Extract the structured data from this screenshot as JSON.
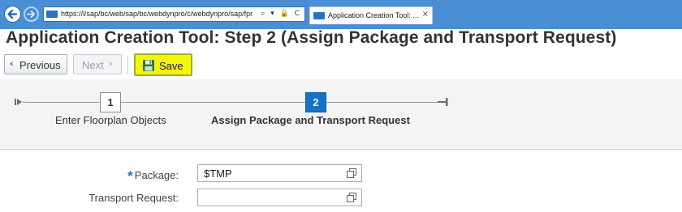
{
  "browser": {
    "address_url": "https://l/sap/bc/web/sap/bc/webdynpro/c/webdynpro/sap/fpr",
    "address_icons": "⌕ ▾ 🔒 C",
    "tab_title": "Application Creation Tool: ...",
    "tab_close": "×"
  },
  "page": {
    "title": "Application Creation Tool: Step 2  (Assign Package and Transport Request)"
  },
  "toolbar": {
    "previous_label": "Previous",
    "previous_icon": "‹",
    "next_label": "Next",
    "next_icon": "›",
    "save_label": "Save"
  },
  "roadmap": {
    "steps": [
      {
        "number": "1",
        "label": "Enter Floorplan Objects",
        "state": "done"
      },
      {
        "number": "2",
        "label": "Assign Package and Transport Request",
        "state": "current"
      }
    ]
  },
  "form": {
    "package": {
      "label": "Package:",
      "required_marker": "*",
      "value": "$TMP"
    },
    "transport": {
      "label": "Transport Request:",
      "value": ""
    }
  },
  "colors": {
    "chrome": "#4a8fd6",
    "accent": "#1473c2",
    "save_highlight": "#f6f60c"
  }
}
